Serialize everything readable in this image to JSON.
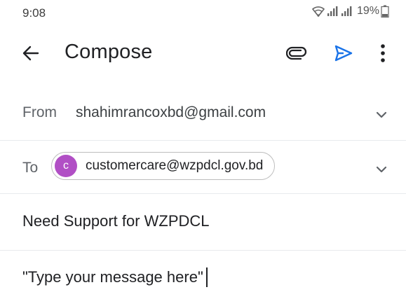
{
  "status_bar": {
    "time": "9:08",
    "battery": "19%",
    "icons": [
      "wifi-icon",
      "signal-icon",
      "signal-icon",
      "battery-icon"
    ]
  },
  "app_bar": {
    "title": "Compose",
    "icons": [
      "back-arrow-icon",
      "attachment-icon",
      "send-icon",
      "more-vert-icon"
    ],
    "send_color": "#1a73e8"
  },
  "from": {
    "label": "From",
    "value": "shahimrancoxbd@gmail.com"
  },
  "to": {
    "label": "To",
    "recipient_initial": "c",
    "recipient": "customercare@wzpdcl.gov.bd",
    "avatar_color": "#b14fc5"
  },
  "subject": {
    "value": "Need Support for WZPDCL"
  },
  "body": {
    "value": "\"Type your message here\""
  }
}
